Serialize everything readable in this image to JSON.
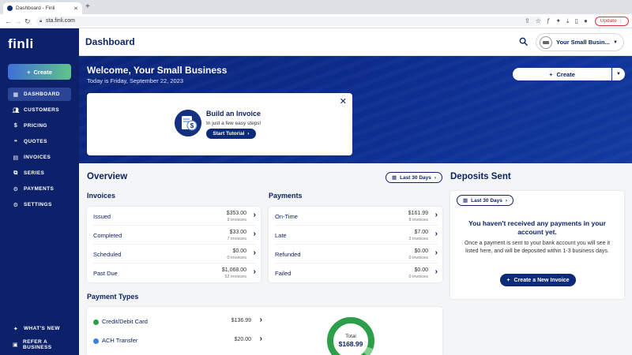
{
  "browser": {
    "tab_title": "Dashboard - Finli",
    "url": "sta.finli.com",
    "update_label": "Update"
  },
  "sidebar": {
    "logo": "finli",
    "create_label": "Create",
    "items": [
      {
        "label": "DASHBOARD",
        "icon": "dashboard-icon",
        "active": true
      },
      {
        "label": "CUSTOMERS",
        "icon": "customers-icon"
      },
      {
        "label": "PRICING",
        "icon": "pricing-icon"
      },
      {
        "label": "QUOTES",
        "icon": "quotes-icon"
      },
      {
        "label": "INVOICES",
        "icon": "invoices-icon"
      },
      {
        "label": "SERIES",
        "icon": "series-icon"
      },
      {
        "label": "PAYMENTS",
        "icon": "payments-icon"
      },
      {
        "label": "SETTINGS",
        "icon": "settings-icon"
      }
    ],
    "bottom_items": [
      {
        "label": "WHAT'S NEW",
        "icon": "sparkle-icon"
      },
      {
        "label": "REFER A BUSINESS",
        "icon": "gift-icon"
      }
    ]
  },
  "header": {
    "title": "Dashboard",
    "account_name": "Your Small Busin..."
  },
  "hero": {
    "welcome": "Welcome, Your Small Business",
    "today": "Today is Friday, September 22, 2023",
    "create_label": "Create",
    "card": {
      "title": "Build an Invoice",
      "subtitle": "In just a few easy steps!",
      "button": "Start Tutorial"
    }
  },
  "overview": {
    "title": "Overview",
    "range": "Last 30 Days",
    "invoices": {
      "title": "Invoices",
      "rows": [
        {
          "label": "Issued",
          "amount": "$353.00",
          "count": "9 invoices"
        },
        {
          "label": "Completed",
          "amount": "$33.00",
          "count": "7 invoices"
        },
        {
          "label": "Scheduled",
          "amount": "$0.00",
          "count": "0 invoices"
        },
        {
          "label": "Past Due",
          "amount": "$1,068.00",
          "count": "52 invoices"
        }
      ]
    },
    "payments": {
      "title": "Payments",
      "rows": [
        {
          "label": "On-Time",
          "amount": "$161.99",
          "count": "8 invoices"
        },
        {
          "label": "Late",
          "amount": "$7.00",
          "count": "2 invoices"
        },
        {
          "label": "Refunded",
          "amount": "$0.00",
          "count": "0 invoices"
        },
        {
          "label": "Failed",
          "amount": "$0.00",
          "count": "0 invoices"
        }
      ]
    },
    "payment_types": {
      "title": "Payment Types",
      "rows": [
        {
          "label": "Credit/Debit Card",
          "amount": "$136.99",
          "color": "#2e9e4a"
        },
        {
          "label": "ACH Transfer",
          "amount": "$20.00",
          "color": "#3b7fe0"
        }
      ],
      "total_label": "Total",
      "total_value": "$168.99"
    }
  },
  "deposits": {
    "title": "Deposits Sent",
    "range": "Last 30 Days",
    "heading": "You haven't received any payments in your account yet.",
    "body": "Once a payment is sent to your bank account you will see it listed here, and will be deposited within 1-3 business days.",
    "button": "Create a New Invoice"
  }
}
